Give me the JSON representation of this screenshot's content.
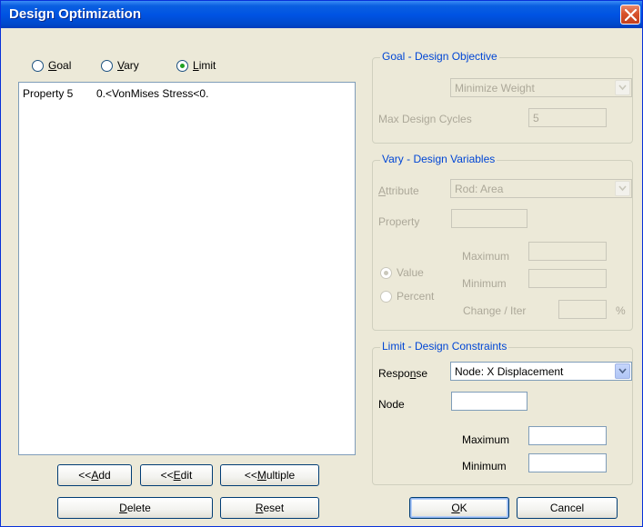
{
  "window": {
    "title": "Design Optimization"
  },
  "mode": {
    "goal": {
      "pre": "",
      "key": "G",
      "post": "oal"
    },
    "vary": {
      "pre": "",
      "key": "V",
      "post": "ary"
    },
    "limit": {
      "pre": "",
      "key": "L",
      "post": "imit"
    },
    "selected": "limit"
  },
  "list": {
    "rows": [
      {
        "name": "Property 5",
        "desc": "0.<VonMises Stress<0."
      }
    ]
  },
  "buttons": {
    "add": {
      "pre": "<< ",
      "key": "A",
      "post": "dd"
    },
    "edit": {
      "pre": "<< ",
      "key": "E",
      "post": "dit"
    },
    "multiple": {
      "pre": "<< ",
      "key": "M",
      "post": "ultiple"
    },
    "delete": {
      "pre": "",
      "key": "D",
      "post": "elete"
    },
    "reset": {
      "pre": "",
      "key": "R",
      "post": "eset"
    },
    "ok": {
      "pre": "",
      "key": "O",
      "post": "K"
    },
    "cancel": "Cancel"
  },
  "goal": {
    "title": "Goal - Design Objective",
    "objective": "Minimize Weight",
    "max_cycles_label": "Max Design Cycles",
    "max_cycles": "5"
  },
  "vary": {
    "title": "Vary - Design Variables",
    "attribute_label": "Attribute",
    "attribute": "Rod: Area",
    "property_label": "Property",
    "maximum_label": "Maximum",
    "minimum_label": "Minimum",
    "value_label": "Value",
    "percent_label": "Percent",
    "change_label": "Change / Iter",
    "percent_sign": "%"
  },
  "limit": {
    "title": "Limit - Design Constraints",
    "response_label": {
      "pre": "Respo",
      "key": "n",
      "post": "se"
    },
    "response": "Node: X Displacement",
    "node_label": "Node",
    "maximum_label": "Maximum",
    "minimum_label": "Minimum"
  }
}
